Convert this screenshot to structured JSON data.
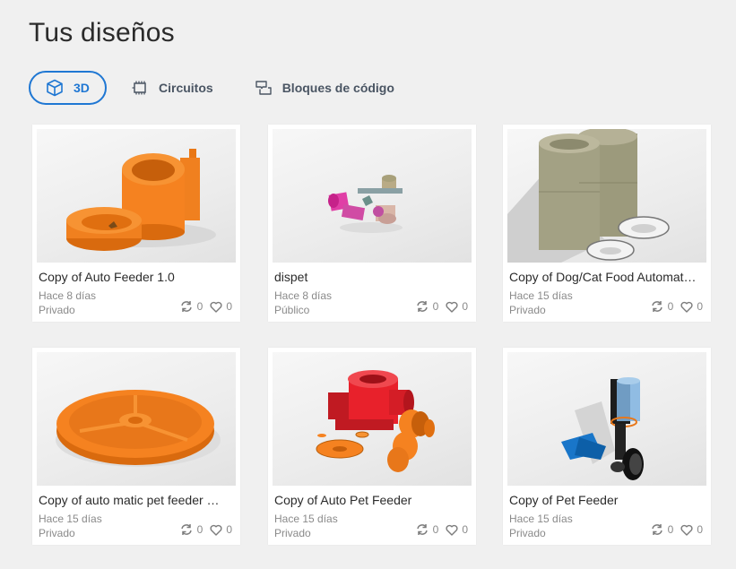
{
  "page": {
    "title": "Tus diseños"
  },
  "tabs": [
    {
      "label": "3D",
      "icon": "cube-icon",
      "active": true
    },
    {
      "label": "Circuitos",
      "icon": "chip-icon",
      "active": false
    },
    {
      "label": "Bloques de código",
      "icon": "code-blocks-icon",
      "active": false
    }
  ],
  "colors": {
    "accent": "#1f77d3",
    "model_orange": "#f58220",
    "model_red": "#e8212b"
  },
  "designs": [
    {
      "name": "Copy of Auto Feeder 1.0",
      "date": "Hace 8 días",
      "visibility": "Privado",
      "copies": "0",
      "likes": "0"
    },
    {
      "name": "dispet",
      "date": "Hace 8 días",
      "visibility": "Público",
      "copies": "0",
      "likes": "0"
    },
    {
      "name": "Copy of Dog/Cat Food Automat…",
      "date": "Hace 15 días",
      "visibility": "Privado",
      "copies": "0",
      "likes": "0"
    },
    {
      "name": "Copy of auto matic pet feeder …",
      "date": "Hace 15 días",
      "visibility": "Privado",
      "copies": "0",
      "likes": "0"
    },
    {
      "name": "Copy of Auto Pet Feeder",
      "date": "Hace 15 días",
      "visibility": "Privado",
      "copies": "0",
      "likes": "0"
    },
    {
      "name": "Copy of Pet Feeder",
      "date": "Hace 15 días",
      "visibility": "Privado",
      "copies": "0",
      "likes": "0"
    }
  ]
}
